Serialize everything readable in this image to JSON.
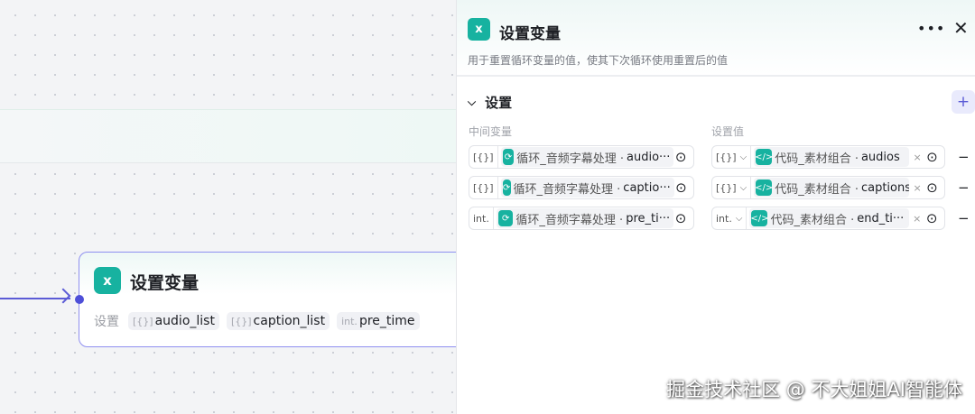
{
  "node": {
    "title": "设置变量",
    "label": "设置",
    "chips": [
      {
        "type": "[{}]",
        "name": "audio_list"
      },
      {
        "type": "[{}]",
        "name": "caption_list"
      },
      {
        "type": "int.",
        "name": "pre_time"
      }
    ]
  },
  "panel": {
    "title": "设置变量",
    "description": "用于重置循环变量的值，使其下次循环使用重置后的值",
    "section": "设置",
    "col_left": "中间变量",
    "col_right": "设置值",
    "rows": [
      {
        "ltype": "[{}]",
        "lsrc": "循环_音频字幕处理 ·",
        "lvar": "audio···",
        "rtype": "[{}]",
        "rsrc": "代码_素材组合 ·",
        "rvar": "audios"
      },
      {
        "ltype": "[{}]",
        "lsrc": "循环_音频字幕处理 ·",
        "lvar": "captio···",
        "rtype": "[{}]",
        "rsrc": "代码_素材组合 ·",
        "rvar": "captions"
      },
      {
        "ltype": "int.",
        "lsrc": "循环_音频字幕处理 ·",
        "lvar": "pre_ti···",
        "rtype": "int.",
        "rsrc": "代码_素材组合 ·",
        "rvar": "end_ti···"
      }
    ]
  },
  "watermark": "掘金技术社区 @ 不大姐姐AI智能体",
  "colors": {
    "accent": "#5b5bd6",
    "teal": "#17b2a0"
  }
}
